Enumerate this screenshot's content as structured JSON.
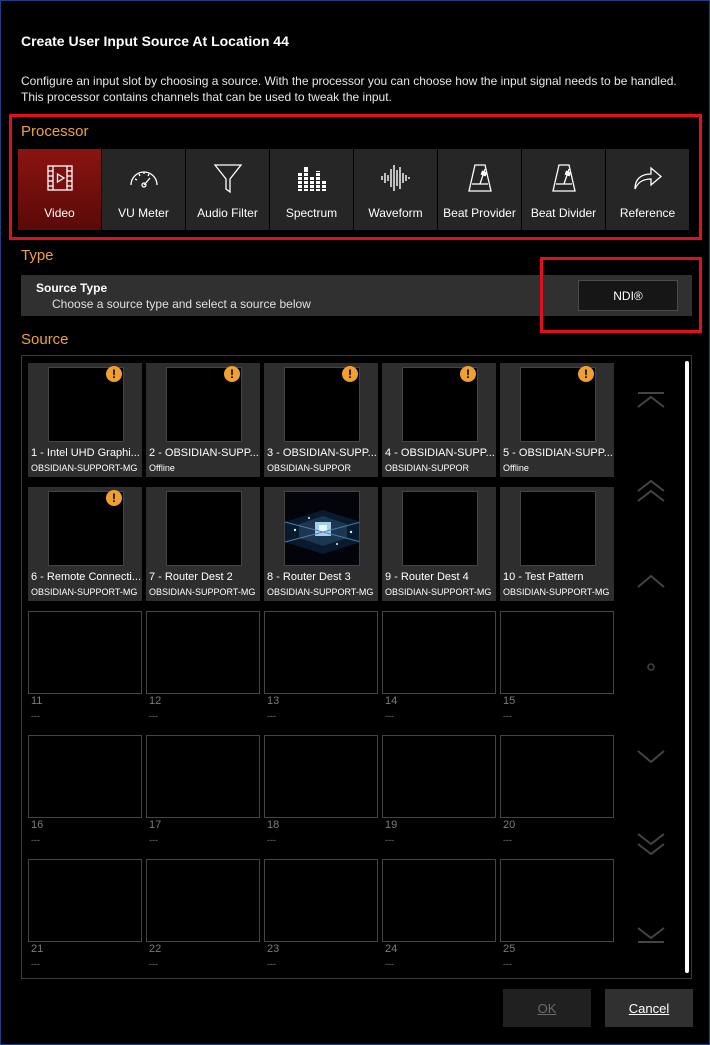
{
  "dialog": {
    "title": "Create User Input Source At Location 44",
    "description": "Configure an input slot by choosing a source. With the processor you can choose how the input signal needs to be handled. This processor contains channels that can be used to tweak the input."
  },
  "processor": {
    "label": "Processor",
    "items": [
      {
        "label": "Video",
        "icon": "film-icon",
        "active": true
      },
      {
        "label": "VU Meter",
        "icon": "gauge-icon"
      },
      {
        "label": "Audio Filter",
        "icon": "funnel-icon"
      },
      {
        "label": "Spectrum",
        "icon": "spectrum-icon"
      },
      {
        "label": "Waveform",
        "icon": "waveform-icon"
      },
      {
        "label": "Beat Provider",
        "icon": "metronome-icon"
      },
      {
        "label": "Beat Divider",
        "icon": "metronome-icon"
      },
      {
        "label": "Reference",
        "icon": "forward-arrow-icon"
      }
    ]
  },
  "type": {
    "label": "Type",
    "source_type_title": "Source Type",
    "source_type_subtitle": "Choose a source type and select a source below",
    "selected": "NDI®"
  },
  "source": {
    "label": "Source",
    "tiles": [
      {
        "name": "1 - Intel UHD Graphi...",
        "sub": "OBSIDIAN-SUPPORT-MG",
        "warning": true,
        "filled": true
      },
      {
        "name": "2 - OBSIDIAN-SUPP...",
        "sub": "Offline",
        "warning": true,
        "filled": true
      },
      {
        "name": "3 - OBSIDIAN-SUPP...",
        "sub": "OBSIDIAN-SUPPOR",
        "warning": true,
        "filled": true
      },
      {
        "name": "4 - OBSIDIAN-SUPP...",
        "sub": "OBSIDIAN-SUPPOR",
        "warning": true,
        "filled": true
      },
      {
        "name": "5 - OBSIDIAN-SUPP...",
        "sub": "Offline",
        "warning": true,
        "filled": true
      },
      {
        "name": "6 - Remote Connecti...",
        "sub": "OBSIDIAN-SUPPORT-MG",
        "warning": true,
        "filled": true
      },
      {
        "name": "7 - Router Dest 2",
        "sub": "OBSIDIAN-SUPPORT-MG",
        "warning": false,
        "filled": true
      },
      {
        "name": "8 - Router Dest 3",
        "sub": "OBSIDIAN-SUPPORT-MG",
        "warning": false,
        "filled": true,
        "preview": true
      },
      {
        "name": "9 - Router Dest 4",
        "sub": "OBSIDIAN-SUPPORT-MG",
        "warning": false,
        "filled": true
      },
      {
        "name": "10 - Test Pattern",
        "sub": "OBSIDIAN-SUPPORT-MG",
        "warning": false,
        "filled": true
      },
      {
        "name": "11",
        "sub": "---"
      },
      {
        "name": "12",
        "sub": "---"
      },
      {
        "name": "13",
        "sub": "---"
      },
      {
        "name": "14",
        "sub": "---"
      },
      {
        "name": "15",
        "sub": "---"
      },
      {
        "name": "16",
        "sub": "---"
      },
      {
        "name": "17",
        "sub": "---"
      },
      {
        "name": "18",
        "sub": "---"
      },
      {
        "name": "19",
        "sub": "---"
      },
      {
        "name": "20",
        "sub": "---"
      },
      {
        "name": "21",
        "sub": "---"
      },
      {
        "name": "22",
        "sub": "---"
      },
      {
        "name": "23",
        "sub": "---"
      },
      {
        "name": "24",
        "sub": "---"
      },
      {
        "name": "25",
        "sub": "---"
      }
    ],
    "warning_glyph": "!"
  },
  "nav": [
    "scroll-top-icon",
    "page-up-icon",
    "line-up-icon",
    "center-dot-icon",
    "line-down-icon",
    "page-down-icon",
    "scroll-bottom-icon"
  ],
  "buttons": {
    "ok": "OK",
    "cancel": "Cancel"
  },
  "colors": {
    "accent": "#f0a040",
    "highlight": "#e01020",
    "active_button": "#8a1410",
    "warning": "#f0a030"
  }
}
